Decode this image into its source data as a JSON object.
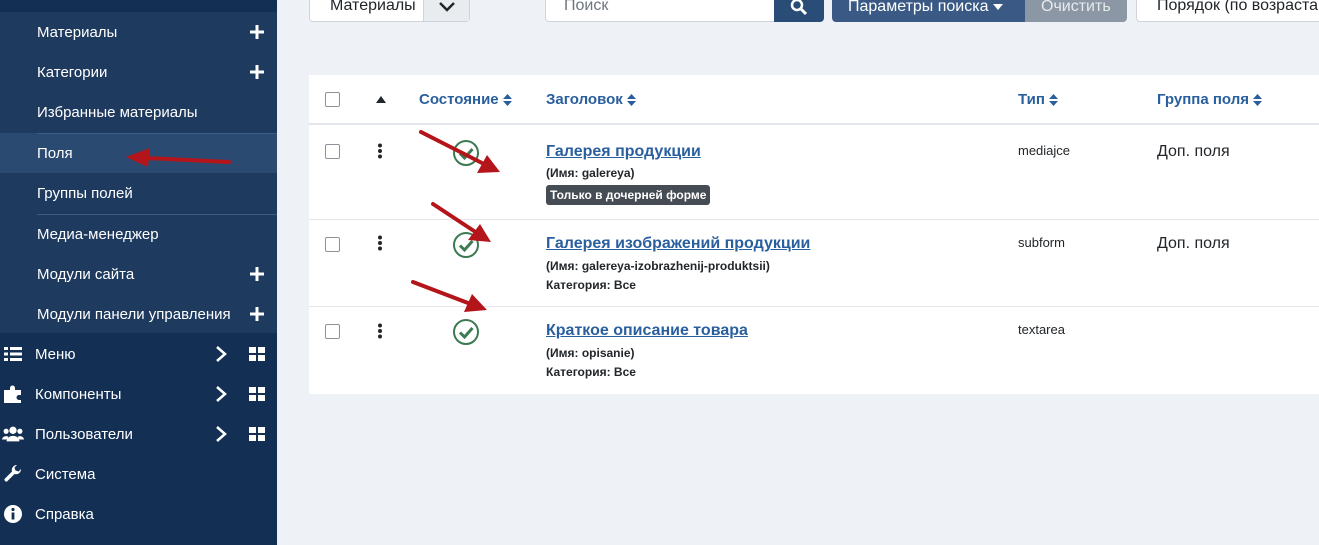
{
  "sidebar": {
    "sub_items": [
      {
        "label": "Материалы",
        "has_plus": true
      },
      {
        "label": "Категории",
        "has_plus": true
      },
      {
        "label": "Избранные материалы",
        "has_plus": false
      },
      {
        "label": "Поля",
        "has_plus": false,
        "active": true
      },
      {
        "label": "Группы полей",
        "has_plus": false
      },
      {
        "label": "Медиа-менеджер",
        "has_plus": false
      },
      {
        "label": "Модули сайта",
        "has_plus": true
      },
      {
        "label": "Модули панели управления",
        "has_plus": true
      }
    ],
    "main_items": [
      {
        "label": "Меню",
        "icon": "list-icon"
      },
      {
        "label": "Компоненты",
        "icon": "puzzle-icon"
      },
      {
        "label": "Пользователи",
        "icon": "users-icon"
      },
      {
        "label": "Система",
        "icon": "wrench-icon"
      },
      {
        "label": "Справка",
        "icon": "info-icon"
      }
    ]
  },
  "toolbar": {
    "context_select": "Материалы",
    "search_placeholder": "Поиск",
    "search_options_label": "Параметры поиска",
    "clear_label": "Очистить",
    "ordering_select": "Порядок (по возраста"
  },
  "table": {
    "headers": {
      "state": "Состояние",
      "title": "Заголовок",
      "type": "Тип",
      "group": "Группа поля"
    },
    "rows": [
      {
        "title": "Галерея продукции",
        "name": "(Имя: galereya)",
        "badge": "Только в дочерней форме",
        "category": "",
        "type": "mediajce",
        "group": "Доп. поля"
      },
      {
        "title": "Галерея изображений продукции",
        "name": "(Имя: galereya-izobrazhenij-produktsii)",
        "badge": "",
        "category": "Категория: Все",
        "type": "subform",
        "group": "Доп. поля"
      },
      {
        "title": "Краткое описание товара",
        "name": "(Имя: opisanie)",
        "badge": "",
        "category": "Категория: Все",
        "type": "textarea",
        "group": ""
      }
    ]
  },
  "colors": {
    "sidebar_bg": "#132f53",
    "submenu_bg": "#1e3a5e",
    "link_blue": "#2a5f9e",
    "published_green": "#3c7a52",
    "arrow_red": "#b3151a"
  }
}
